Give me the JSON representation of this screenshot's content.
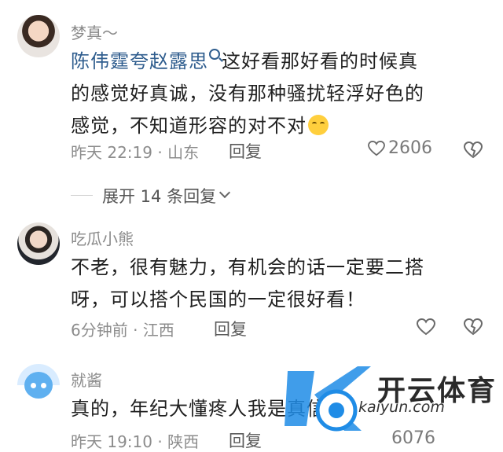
{
  "comments": [
    {
      "name": "梦真～",
      "mention": "陈伟霆夸赵露思",
      "text_line1": "这好看那好看的时候真",
      "text_line2": "的感觉好真诚，没有那种骚扰轻浮好色的",
      "text_line3": "感觉，不知道形容的对不对",
      "meta": "昨天 22:19 · 山东",
      "reply_label": "回复",
      "like_count": "2606"
    },
    {
      "name": "吃瓜小熊",
      "text_line1": "不老，很有魅力，有机会的话一定要二搭",
      "text_line2": "呀，可以搭个民国的一定很好看！",
      "meta": "6分钟前 · 江西",
      "reply_label": "回复"
    },
    {
      "name": "就酱",
      "text_line1": "真的，年纪大懂疼人我是真信了",
      "meta": "昨天 19:10 · 陕西",
      "reply_label": "回复",
      "like_count": "6076"
    }
  ],
  "expand_replies": "展开 14 条回复",
  "watermark": {
    "brand": "开云体育",
    "sub": "kaiyun.com"
  },
  "colors": {
    "mention": "#2f5d8e",
    "meta": "#8c8c8c",
    "text": "#202020"
  }
}
